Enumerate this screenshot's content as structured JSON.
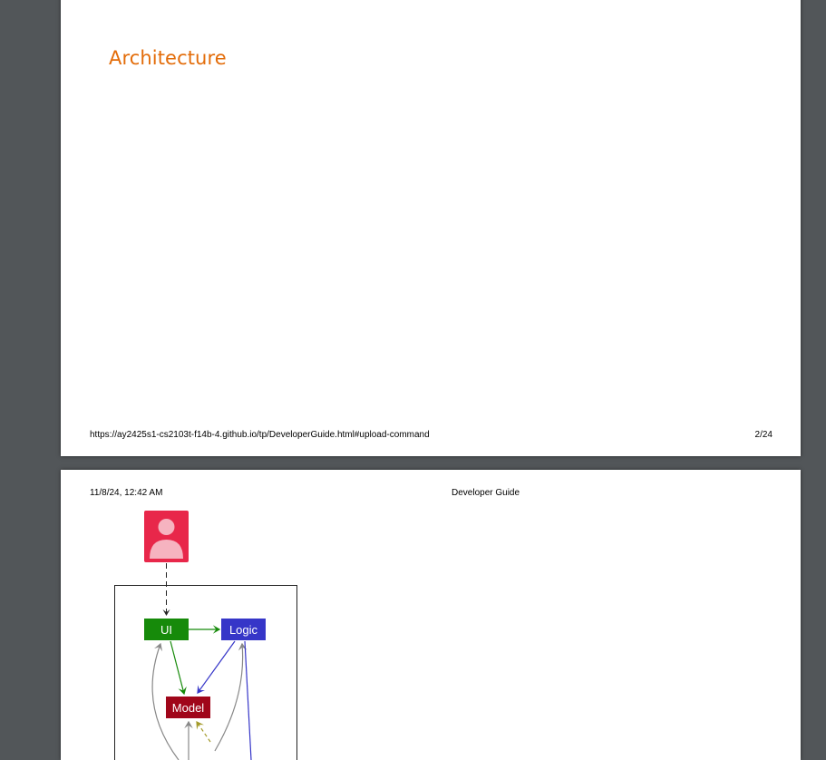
{
  "viewer": {
    "background": "#525659"
  },
  "page1": {
    "heading": "Architecture",
    "heading_color": "#e36c09",
    "footer_url": "https://ay2425s1-cs2103t-f14b-4.github.io/tp/DeveloperGuide.html#upload-command",
    "footer_page": "2/24"
  },
  "page2": {
    "header_date": "11/8/24, 12:42 AM",
    "header_title": "Developer Guide",
    "diagram": {
      "components": [
        {
          "label": "UI",
          "color": "#168a0a"
        },
        {
          "label": "Logic",
          "color": "#3636c8"
        },
        {
          "label": "Model",
          "color": "#a0061a"
        }
      ],
      "user_icon": "user-icon",
      "user_color": "#e8274a"
    }
  }
}
